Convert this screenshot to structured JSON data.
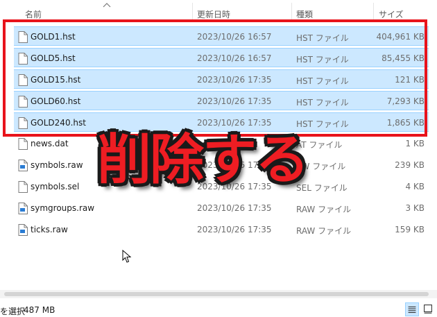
{
  "columns": {
    "name": "名前",
    "date": "更新日時",
    "type": "種類",
    "size": "サイズ"
  },
  "files": [
    {
      "name": "GOLD1.hst",
      "date": "2023/10/26 16:57",
      "type": "HST ファイル",
      "size": "404,961 KB",
      "selected": true
    },
    {
      "name": "GOLD5.hst",
      "date": "2023/10/26 16:57",
      "type": "HST ファイル",
      "size": "85,455 KB",
      "selected": true
    },
    {
      "name": "GOLD15.hst",
      "date": "2023/10/26 17:35",
      "type": "HST ファイル",
      "size": "121 KB",
      "selected": true
    },
    {
      "name": "GOLD60.hst",
      "date": "2023/10/26 17:35",
      "type": "HST ファイル",
      "size": "7,293 KB",
      "selected": true
    },
    {
      "name": "GOLD240.hst",
      "date": "2023/10/26 17:35",
      "type": "HST ファイル",
      "size": "1,865 KB",
      "selected": true
    },
    {
      "name": "news.dat",
      "date": "",
      "type": "AT ファイル",
      "size": "1 KB",
      "selected": false
    },
    {
      "name": "symbols.raw",
      "date": "2023/10/26 17:35",
      "type": "AW ファイル",
      "size": "239 KB",
      "selected": false
    },
    {
      "name": "symbols.sel",
      "date": "2023/10/26 17:35",
      "type": "SEL ファイル",
      "size": "4 KB",
      "selected": false
    },
    {
      "name": "symgroups.raw",
      "date": "2023/10/26 17:35",
      "type": "RAW ファイル",
      "size": "3 KB",
      "selected": false
    },
    {
      "name": "ticks.raw",
      "date": "2023/10/26 17:35",
      "type": "RAW ファイル",
      "size": "159 KB",
      "selected": false
    }
  ],
  "overlay": {
    "text": "削除する",
    "color": "#ee1d23",
    "box_color": "#e8131b"
  },
  "status": {
    "selection": "を選択",
    "size": "487 MB"
  },
  "icons": {
    "document": "document-icon",
    "raw": "raw-file-icon",
    "details_view": "details-view-icon",
    "tiles_view": "tiles-view-icon",
    "sort": "sort-up-icon",
    "cursor": "mouse-cursor-icon"
  }
}
